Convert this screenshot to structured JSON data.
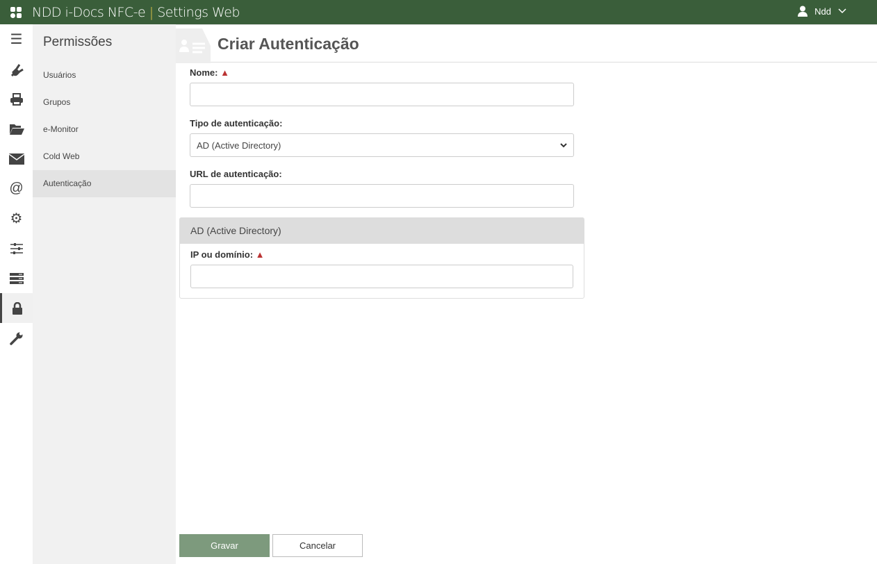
{
  "header": {
    "title_main": "NDD i-Docs NFC-e",
    "title_sep": "|",
    "title_sub": "Settings Web",
    "user": "Ndd"
  },
  "rail": [
    "menu-icon",
    "plug-icon",
    "printer-icon",
    "folder-open-icon",
    "envelope-icon",
    "at-icon",
    "gear-icon",
    "sliders-icon",
    "server-icon",
    "lock-icon",
    "wrench-icon"
  ],
  "subnav": {
    "title": "Permissões",
    "items": [
      {
        "label": "Usuários"
      },
      {
        "label": "Grupos"
      },
      {
        "label": "e-Monitor"
      },
      {
        "label": "Cold Web"
      },
      {
        "label": "Autenticação",
        "active": true
      }
    ]
  },
  "page": {
    "title": "Criar Autenticação"
  },
  "form": {
    "name_label": "Nome:",
    "name_value": "",
    "type_label": "Tipo de autenticação:",
    "type_value": "AD (Active Directory)",
    "url_label": "URL de autenticação:",
    "url_value": ""
  },
  "panel": {
    "title": "AD (Active Directory)",
    "ip_label": "IP ou domínio:",
    "ip_value": ""
  },
  "buttons": {
    "save": "Gravar",
    "cancel": "Cancelar"
  },
  "colors": {
    "topbar": "#3a5e3a",
    "accent": "#e8c84a",
    "warning": "#b33333",
    "save_button": "#7d9a7d"
  }
}
